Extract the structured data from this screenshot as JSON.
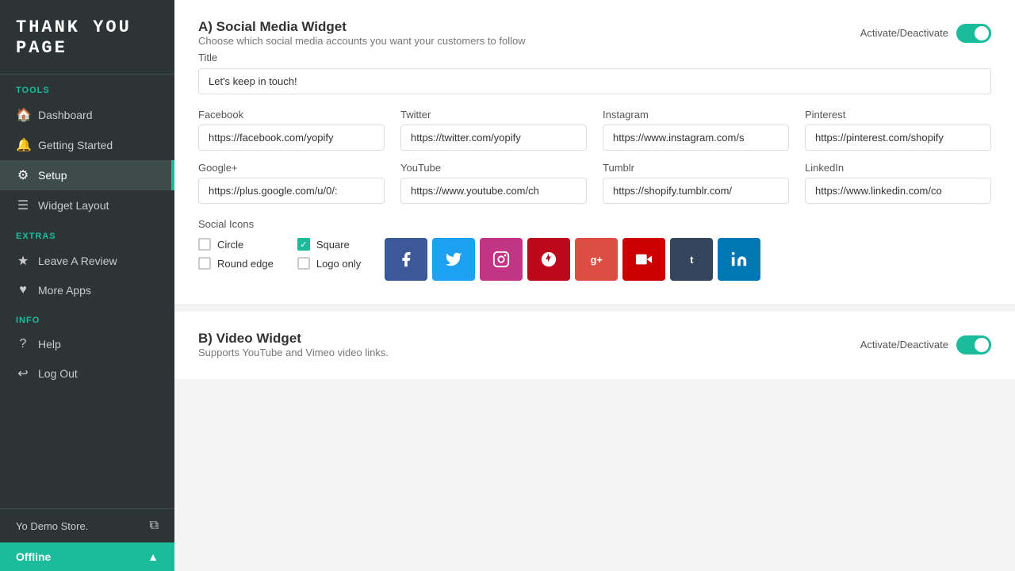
{
  "sidebar": {
    "logo": "THANK  YOU  PAGe",
    "sections": [
      {
        "label": "Tools",
        "items": [
          {
            "id": "dashboard",
            "icon": "🏠",
            "text": "Dashboard",
            "active": false
          },
          {
            "id": "getting-started",
            "icon": "🔔",
            "text": "Getting Started",
            "active": false
          },
          {
            "id": "setup",
            "icon": "⚙",
            "text": "Setup",
            "active": true
          },
          {
            "id": "widget-layout",
            "icon": "☰",
            "text": "Widget Layout",
            "active": false
          }
        ]
      },
      {
        "label": "Extras",
        "items": [
          {
            "id": "leave-review",
            "icon": "★",
            "text": "Leave A Review",
            "active": false
          },
          {
            "id": "more-apps",
            "icon": "♥",
            "text": "More Apps",
            "active": false
          }
        ]
      },
      {
        "label": "Info",
        "items": [
          {
            "id": "help",
            "icon": "?",
            "text": "Help",
            "active": false
          },
          {
            "id": "log-out",
            "icon": "↩",
            "text": "Log Out",
            "active": false
          }
        ]
      }
    ],
    "footer": {
      "store_name": "Yo Demo Store.",
      "ext_icon": "⧉"
    },
    "offline_bar": {
      "label": "Offline",
      "chevron": "▲"
    }
  },
  "main": {
    "social_widget": {
      "title": "A) Social Media Widget",
      "description": "Choose which social media accounts you want your customers to follow",
      "activate_label": "Activate/Deactivate",
      "activated": true,
      "title_field_label": "Title",
      "title_field_value": "Let's keep in touch!",
      "fields": [
        {
          "label": "Facebook",
          "value": "https://facebook.com/yopify"
        },
        {
          "label": "Twitter",
          "value": "https://twitter.com/yopify"
        },
        {
          "label": "Instagram",
          "value": "https://www.instagram.com/s"
        },
        {
          "label": "Pinterest",
          "value": "https://pinterest.com/shopify"
        },
        {
          "label": "Google+",
          "value": "https://plus.google.com/u/0/:"
        },
        {
          "label": "YouTube",
          "value": "https://www.youtube.com/ch"
        },
        {
          "label": "Tumblr",
          "value": "https://shopify.tumblr.com/"
        },
        {
          "label": "LinkedIn",
          "value": "https://www.linkedin.com/co"
        }
      ],
      "social_icons_label": "Social Icons",
      "shape_options": [
        {
          "id": "circle",
          "label": "Circle",
          "checked": false
        },
        {
          "id": "round-edge",
          "label": "Round edge",
          "checked": false
        },
        {
          "id": "square",
          "label": "Square",
          "checked": true
        },
        {
          "id": "logo-only",
          "label": "Logo only",
          "checked": false
        }
      ],
      "icon_previews": [
        {
          "label": "f",
          "color": "#3b5998"
        },
        {
          "label": "t",
          "color": "#1da1f2"
        },
        {
          "label": "ig",
          "color": "#c13584"
        },
        {
          "label": "p",
          "color": "#bd081c"
        },
        {
          "label": "g+",
          "color": "#dc4e41"
        },
        {
          "label": "▶",
          "color": "#ff0000"
        },
        {
          "label": "t",
          "color": "#35465c"
        },
        {
          "label": "in",
          "color": "#0077b5"
        }
      ]
    },
    "video_widget": {
      "title": "B) Video Widget",
      "description": "Supports YouTube and Vimeo video links.",
      "activate_label": "Activate/Deactivate",
      "activated": true
    }
  }
}
